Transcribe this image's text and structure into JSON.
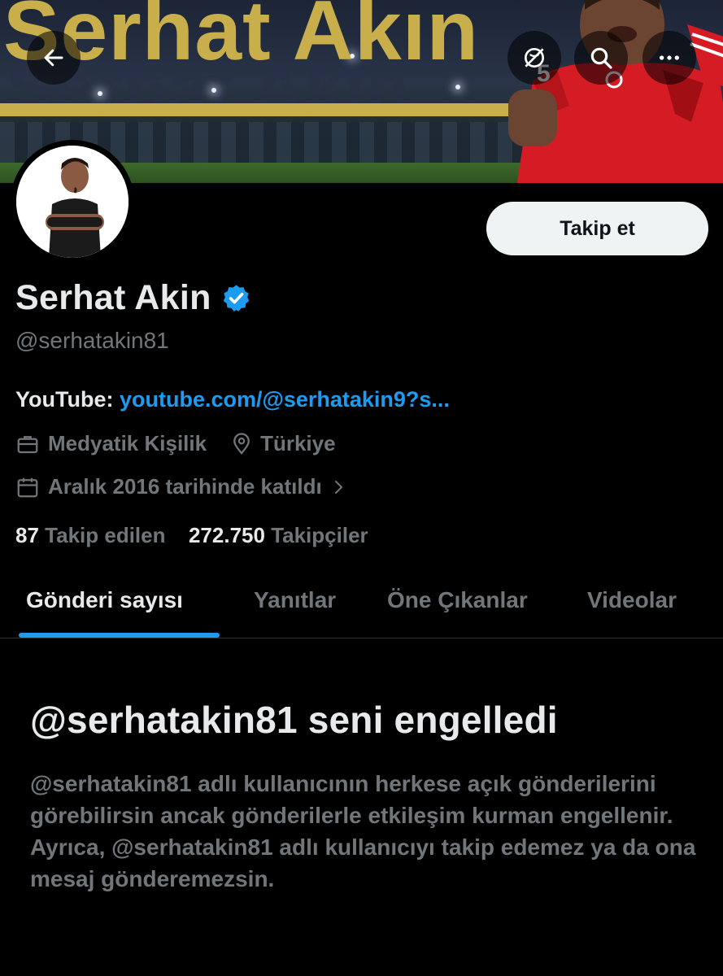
{
  "header": {
    "banner_text": "Serhat Akın",
    "back_icon": "arrow-left-icon",
    "translate_icon": "globe-strike-icon",
    "search_icon": "search-icon",
    "more_icon": "more-horizontal-icon",
    "player_number": "5"
  },
  "profile": {
    "display_name": "Serhat Akin",
    "verified": true,
    "handle": "@serhatakin81",
    "follow_label": "Takip et",
    "bio_label": "YouTube:",
    "bio_link": "youtube.com/@serhatakin9?s...",
    "profession": "Medyatik Kişilik",
    "location": "Türkiye",
    "joined": "Aralık 2016 tarihinde katıldı",
    "following_count": "87",
    "following_label": "Takip edilen",
    "followers_count": "272.750",
    "followers_label": "Takipçiler"
  },
  "tabs": [
    {
      "label": "Gönderi sayısı",
      "active": true
    },
    {
      "label": "Yanıtlar",
      "active": false
    },
    {
      "label": "Öne Çıkanlar",
      "active": false
    },
    {
      "label": "Videolar",
      "active": false
    }
  ],
  "blocked": {
    "title": "@serhatakin81 seni engelledi",
    "body": "@serhatakin81 adlı kullanıcının herkese açık gönderilerini görebilirsin ancak gönderilerle etkileşim kurman engellenir. Ayrıca, @serhatakin81 adlı kullanıcıyı takip edemez ya da ona mesaj gönderemezsin."
  },
  "colors": {
    "background": "#000000",
    "accent": "#1d9bf0",
    "muted_text": "#71767b",
    "primary_text": "#e7e9ea",
    "banner_gold": "#c9ae4c",
    "follow_button": "#eff3f4"
  }
}
